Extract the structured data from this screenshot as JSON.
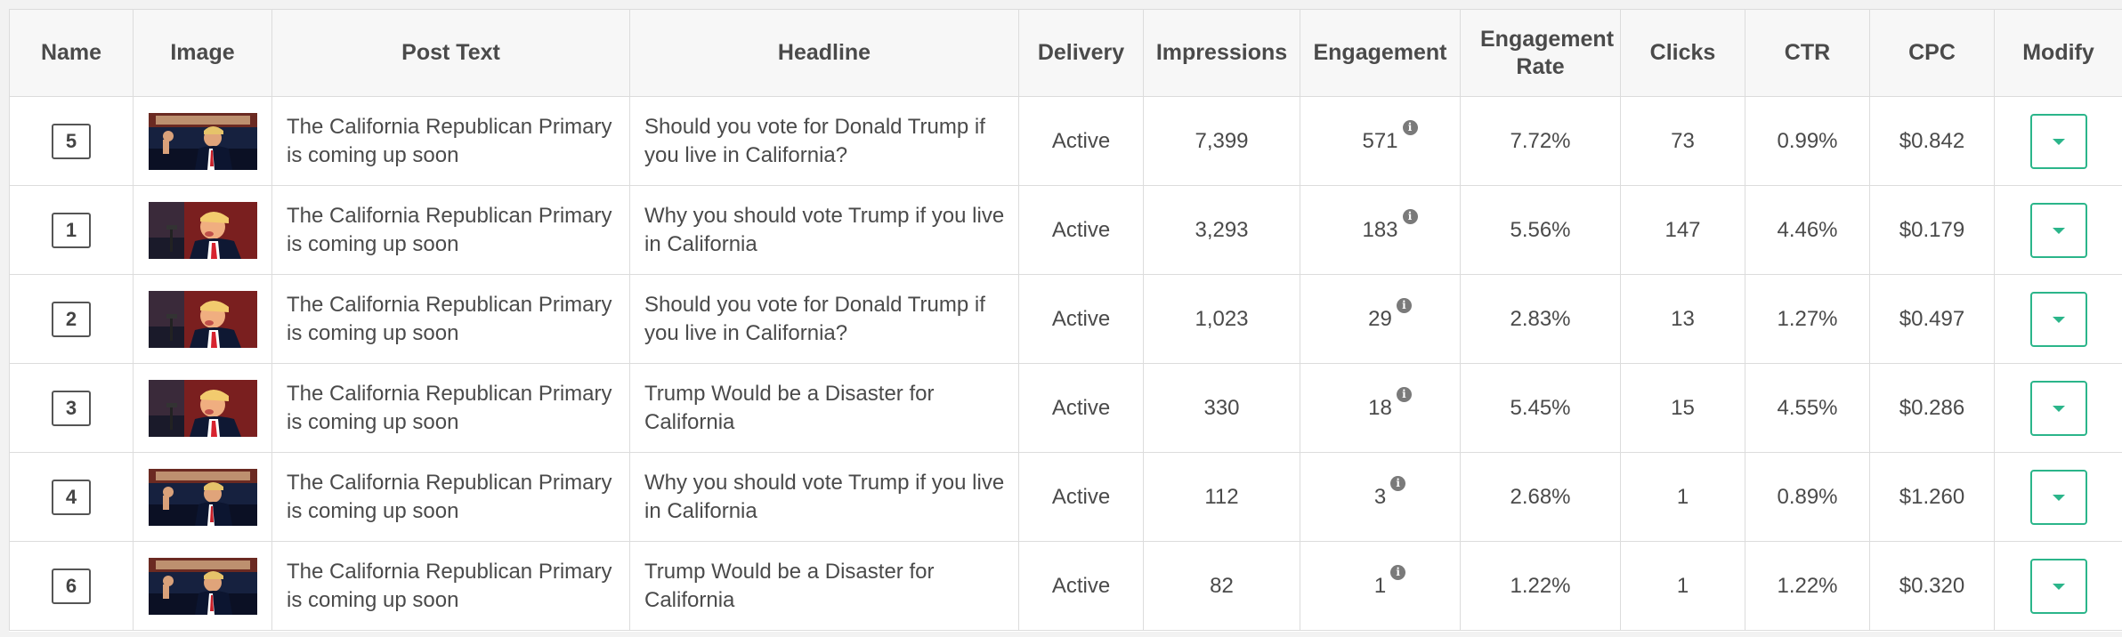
{
  "colors": {
    "accent": "#2bb58a",
    "header_bg": "#f7f7f7",
    "border": "#dcdcdc"
  },
  "columns": [
    "Name",
    "Image",
    "Post Text",
    "Headline",
    "Delivery",
    "Impressions",
    "Engagement",
    "Engagement Rate",
    "Clicks",
    "CTR",
    "CPC",
    "Modify"
  ],
  "rows": [
    {
      "name": "5",
      "image": "crowd-speech-photo",
      "post_text": "The California Republican Primary is coming up soon",
      "headline": "Should you vote for Donald Trump if you live in California?",
      "delivery": "Active",
      "impressions": "7,399",
      "engagement": "571",
      "engagement_rate": "7.72%",
      "clicks": "73",
      "ctr": "0.99%",
      "cpc": "$0.842"
    },
    {
      "name": "1",
      "image": "speaker-closeup-photo",
      "post_text": "The California Republican Primary is coming up soon",
      "headline": "Why you should vote Trump if you live in California",
      "delivery": "Active",
      "impressions": "3,293",
      "engagement": "183",
      "engagement_rate": "5.56%",
      "clicks": "147",
      "ctr": "4.46%",
      "cpc": "$0.179"
    },
    {
      "name": "2",
      "image": "speaker-closeup-photo",
      "post_text": "The California Republican Primary is coming up soon",
      "headline": "Should you vote for Donald Trump if you live in California?",
      "delivery": "Active",
      "impressions": "1,023",
      "engagement": "29",
      "engagement_rate": "2.83%",
      "clicks": "13",
      "ctr": "1.27%",
      "cpc": "$0.497"
    },
    {
      "name": "3",
      "image": "speaker-closeup-photo",
      "post_text": "The California Republican Primary is coming up soon",
      "headline": "Trump Would be a Disaster for California",
      "delivery": "Active",
      "impressions": "330",
      "engagement": "18",
      "engagement_rate": "5.45%",
      "clicks": "15",
      "ctr": "4.55%",
      "cpc": "$0.286"
    },
    {
      "name": "4",
      "image": "crowd-speech-photo",
      "post_text": "The California Republican Primary is coming up soon",
      "headline": "Why you should vote Trump if you live in California",
      "delivery": "Active",
      "impressions": "112",
      "engagement": "3",
      "engagement_rate": "2.68%",
      "clicks": "1",
      "ctr": "0.89%",
      "cpc": "$1.260"
    },
    {
      "name": "6",
      "image": "crowd-speech-photo",
      "post_text": "The California Republican Primary is coming up soon",
      "headline": "Trump Would be a Disaster for California",
      "delivery": "Active",
      "impressions": "82",
      "engagement": "1",
      "engagement_rate": "1.22%",
      "clicks": "1",
      "ctr": "1.22%",
      "cpc": "$0.320"
    }
  ]
}
